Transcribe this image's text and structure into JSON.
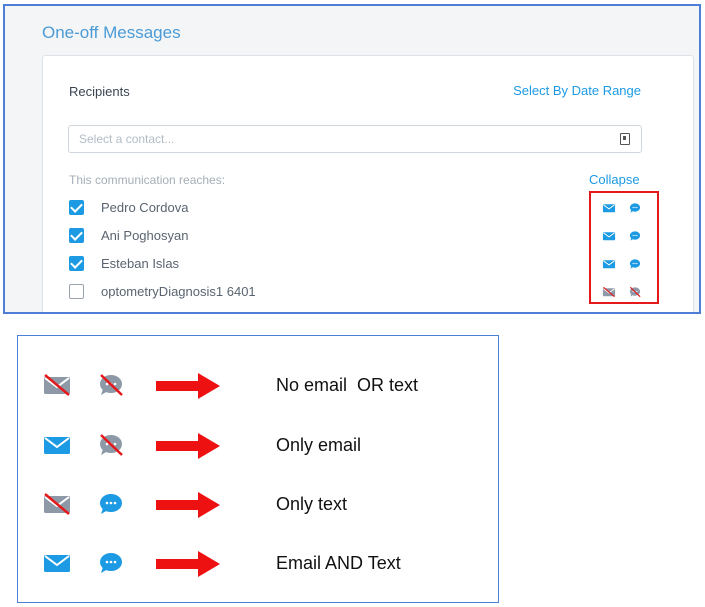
{
  "panel": {
    "title": "One-off Messages",
    "recipients_label": "Recipients",
    "select_by_date_range": "Select By Date Range",
    "search": {
      "placeholder": "Select a contact...",
      "value": ""
    },
    "reaches_label": "This communication reaches:",
    "collapse_label": "Collapse",
    "recipients": [
      {
        "name": "Pedro Cordova",
        "checked": true,
        "email": true,
        "text": true
      },
      {
        "name": "Ani Poghosyan",
        "checked": true,
        "email": true,
        "text": true
      },
      {
        "name": "Esteban Islas",
        "checked": true,
        "email": true,
        "text": true
      },
      {
        "name": "optometryDiagnosis1 6401",
        "checked": false,
        "email": false,
        "text": false
      }
    ]
  },
  "legend": {
    "rows": [
      {
        "label": "No email  OR text",
        "email": false,
        "text": false
      },
      {
        "label": "Only email",
        "email": true,
        "text": false
      },
      {
        "label": "Only text",
        "email": false,
        "text": true
      },
      {
        "label": "Email AND Text",
        "email": true,
        "text": true
      }
    ]
  },
  "icons": {
    "email": "envelope-icon",
    "text": "chat-bubble-icon",
    "disabled_marker": "strike-through",
    "arrow": "right-arrow-icon"
  },
  "colors": {
    "accent": "#1c9ae3",
    "title": "#4a9bd6",
    "icon_disabled": "#8e99a8",
    "strike": "#e5191b",
    "highlight_box": "#e5191b",
    "arrow": "#ee1111",
    "frame": "#4d7fd6"
  }
}
